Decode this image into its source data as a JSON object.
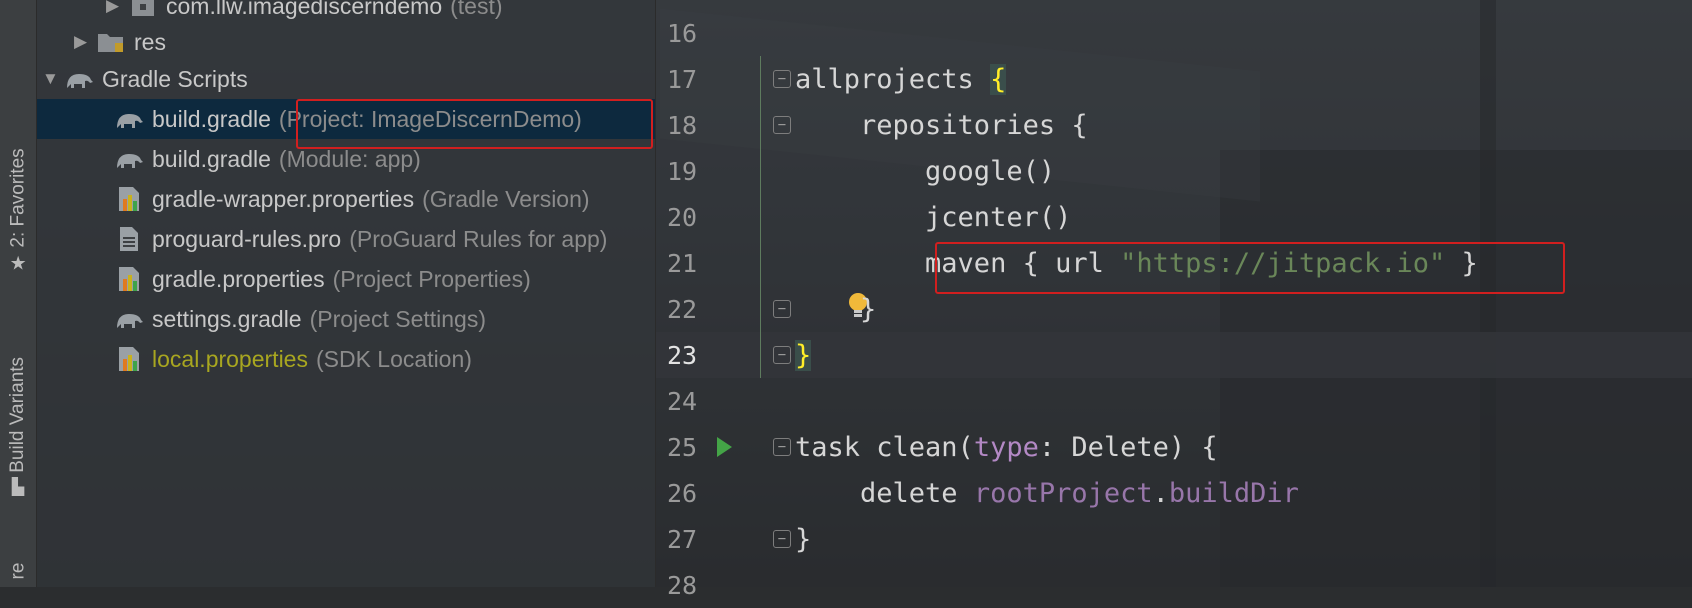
{
  "toolstrip": {
    "favorites_label": "2: Favorites",
    "build_variants_label": "Build Variants",
    "bottom_label": "re"
  },
  "project_tree": {
    "items": [
      {
        "name": "com.llw.imagediscerndemo",
        "hint": "(test)",
        "icon": "package-icon"
      },
      {
        "name": "res",
        "hint": "",
        "icon": "folder-icon"
      },
      {
        "name": "Gradle Scripts",
        "hint": "",
        "icon": "gradle-elephant-icon"
      },
      {
        "name": "build.gradle",
        "hint": "(Project: ImageDiscernDemo)",
        "icon": "gradle-elephant-icon",
        "selected": true
      },
      {
        "name": "build.gradle",
        "hint": "(Module: app)",
        "icon": "gradle-elephant-icon"
      },
      {
        "name": "gradle-wrapper.properties",
        "hint": "(Gradle Version)",
        "icon": "properties-file-icon"
      },
      {
        "name": "proguard-rules.pro",
        "hint": "(ProGuard Rules for app)",
        "icon": "text-file-icon"
      },
      {
        "name": "gradle.properties",
        "hint": "(Project Properties)",
        "icon": "properties-file-icon"
      },
      {
        "name": "settings.gradle",
        "hint": "(Project Settings)",
        "icon": "gradle-elephant-icon"
      },
      {
        "name": "local.properties",
        "hint": "(SDK Location)",
        "icon": "properties-file-icon"
      }
    ]
  },
  "editor": {
    "current_line": 23,
    "lines": [
      {
        "num": "16",
        "parts": []
      },
      {
        "num": "17",
        "parts": [
          {
            "t": "allprojects ",
            "c": "kw"
          },
          {
            "t": "{",
            "c": "brace-hl"
          }
        ]
      },
      {
        "num": "18",
        "parts": [
          {
            "t": "    repositories {",
            "c": "kw"
          }
        ]
      },
      {
        "num": "19",
        "parts": [
          {
            "t": "        google()",
            "c": "kw"
          }
        ]
      },
      {
        "num": "20",
        "parts": [
          {
            "t": "        jcenter()",
            "c": "kw"
          }
        ]
      },
      {
        "num": "21",
        "parts": [
          {
            "t": "        maven { url ",
            "c": "kw"
          },
          {
            "t": "\"https://jitpack.io\"",
            "c": "str"
          },
          {
            "t": " }",
            "c": "kw"
          }
        ]
      },
      {
        "num": "22",
        "parts": [
          {
            "t": "    }",
            "c": "kw"
          }
        ]
      },
      {
        "num": "23",
        "parts": [
          {
            "t": "}",
            "c": "brace-hl"
          }
        ]
      },
      {
        "num": "24",
        "parts": []
      },
      {
        "num": "25",
        "parts": [
          {
            "t": "task clean(",
            "c": "kw"
          },
          {
            "t": "type",
            "c": "named"
          },
          {
            "t": ": Delete) {",
            "c": "kw"
          }
        ]
      },
      {
        "num": "26",
        "parts": [
          {
            "t": "    delete ",
            "c": "kw"
          },
          {
            "t": "rootProject",
            "c": "purple"
          },
          {
            "t": ".",
            "c": "kw"
          },
          {
            "t": "buildDir",
            "c": "purple"
          }
        ]
      },
      {
        "num": "27",
        "parts": [
          {
            "t": "}",
            "c": "kw"
          }
        ]
      },
      {
        "num": "28",
        "parts": []
      }
    ]
  },
  "colors": {
    "highlight_box": "#d11f1f",
    "selection": "#0d293e",
    "string": "#6a8759",
    "property": "#9876aa",
    "run_icon": "#44a447"
  }
}
